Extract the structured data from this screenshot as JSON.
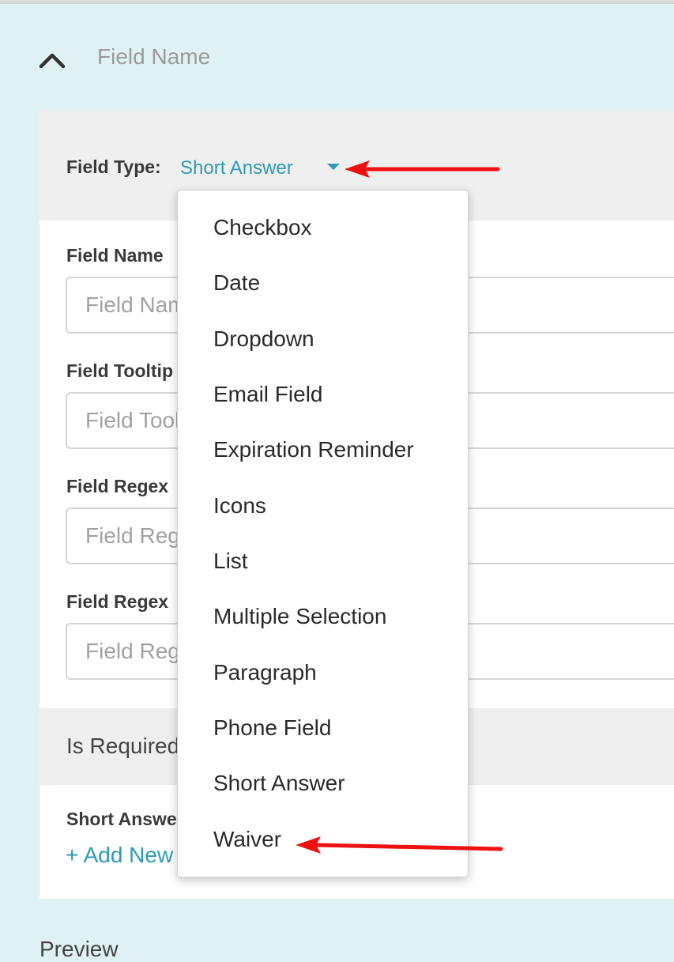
{
  "section": {
    "title": "Field Name",
    "collapse_icon": "chevron-up-icon"
  },
  "field_type": {
    "label": "Field Type:",
    "value": "Short Answer",
    "caret_icon": "caret-down-icon"
  },
  "form": {
    "field_name_label": "Field Name",
    "field_name_placeholder": "Field Name",
    "field_tooltip_label": "Field Tooltip",
    "field_tooltip_placeholder": "Field Tooltip",
    "field_regex_label": "Field Regex",
    "field_regex_placeholder": "Field Regex",
    "field_regex_2_label": "Field Regex",
    "field_regex_2_placeholder": "Field Regex",
    "is_required_label": "Is Required",
    "short_answer_label": "Short Answer",
    "add_new_label": "+ Add New"
  },
  "preview_label": "Preview",
  "dropdown": {
    "options": [
      {
        "label": "Checkbox"
      },
      {
        "label": "Date"
      },
      {
        "label": "Dropdown"
      },
      {
        "label": "Email Field"
      },
      {
        "label": "Expiration Reminder"
      },
      {
        "label": "Icons"
      },
      {
        "label": "List"
      },
      {
        "label": "Multiple Selection"
      },
      {
        "label": "Paragraph"
      },
      {
        "label": "Phone Field"
      },
      {
        "label": "Short Answer"
      },
      {
        "label": "Waiver"
      }
    ]
  },
  "colors": {
    "page_background": "#e0f1f4",
    "accent": "#2e9bb0",
    "annotation_arrow": "#ee1111"
  }
}
